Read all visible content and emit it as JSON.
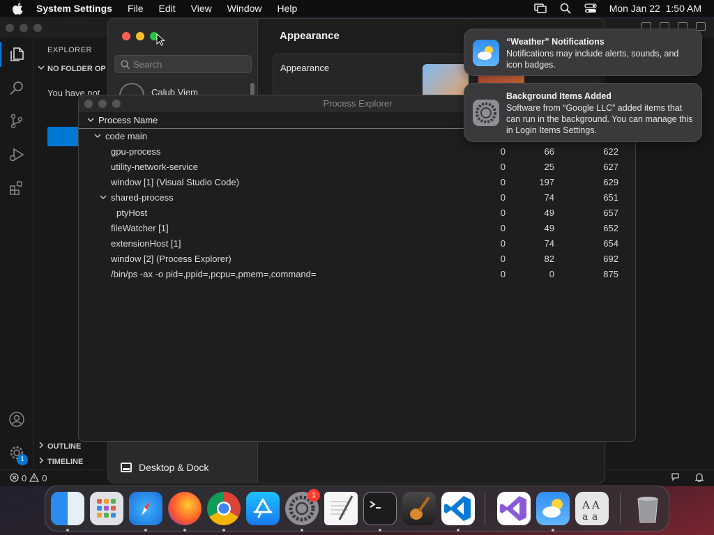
{
  "menubar": {
    "app_name": "System Settings",
    "menus": [
      "File",
      "Edit",
      "View",
      "Window",
      "Help"
    ],
    "datetime": "Mon Jan 22  1:50 AM"
  },
  "vscode": {
    "explorer_title": "EXPLORER",
    "no_folder": "NO FOLDER OP",
    "you_have": "You have not",
    "outline": "OUTLINE",
    "timeline": "TIMELINE",
    "settings_badge": "1",
    "status_errors": "0",
    "status_warnings": "0"
  },
  "system_settings": {
    "search_placeholder": "Search",
    "user_name": "Calub Viem",
    "header": "Appearance",
    "card_title": "Appearance",
    "sidebar_item": "Desktop & Dock"
  },
  "process_explorer": {
    "title": "Process Explorer",
    "column_name": "Process Name",
    "rows": [
      {
        "name": "code main",
        "c1": "",
        "c2": "",
        "c3": ""
      },
      {
        "name": "gpu-process",
        "c1": "0",
        "c2": "66",
        "c3": "622"
      },
      {
        "name": "utility-network-service",
        "c1": "0",
        "c2": "25",
        "c3": "627"
      },
      {
        "name": "window [1] (Visual Studio Code)",
        "c1": "0",
        "c2": "197",
        "c3": "629"
      },
      {
        "name": "shared-process",
        "c1": "0",
        "c2": "74",
        "c3": "651"
      },
      {
        "name": "ptyHost",
        "c1": "0",
        "c2": "49",
        "c3": "657"
      },
      {
        "name": "fileWatcher [1]",
        "c1": "0",
        "c2": "49",
        "c3": "652"
      },
      {
        "name": "extensionHost [1]",
        "c1": "0",
        "c2": "74",
        "c3": "654"
      },
      {
        "name": "window [2] (Process Explorer)",
        "c1": "0",
        "c2": "82",
        "c3": "692"
      },
      {
        "name": "/bin/ps -ax -o pid=,ppid=,pcpu=,pmem=,command=",
        "c1": "0",
        "c2": "0",
        "c3": "875"
      }
    ]
  },
  "notifications": [
    {
      "title": "“Weather” Notifications",
      "body": "Notifications may include alerts, sounds, and icon badges."
    },
    {
      "title": "Background Items Added",
      "body": "Software from “Google LLC” added items that can run in the background. You can manage this in Login Items Settings."
    }
  ],
  "dock": {
    "system_settings_badge": "1"
  }
}
